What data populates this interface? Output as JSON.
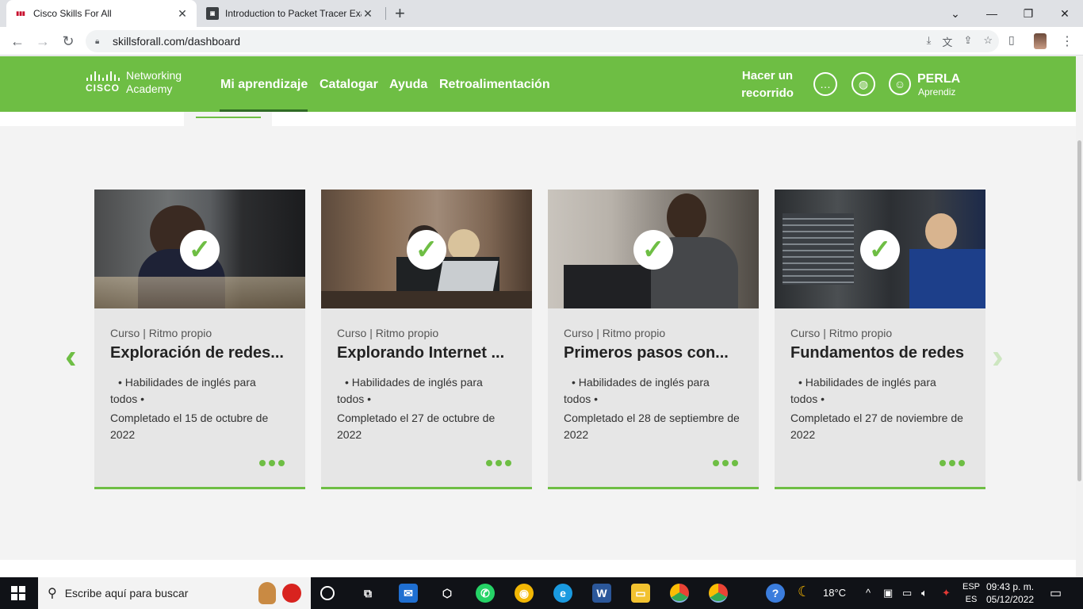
{
  "browser": {
    "tabs": [
      {
        "title": "Cisco Skills For All",
        "active": true,
        "favicon": "cisco-favicon"
      },
      {
        "title": "Introduction to Packet Tracer Exa",
        "active": false,
        "favicon": "packet-tracer-favicon"
      }
    ],
    "url": "skillsforall.com/dashboard"
  },
  "header": {
    "logo_cisco": "CISCO",
    "logo_networking": "Networking",
    "logo_academy": "Academy",
    "nav": [
      "Mi aprendizaje",
      "Catalogar",
      "Ayuda",
      "Retroalimentación"
    ],
    "tour_line1": "Hacer un",
    "tour_line2": "recorrido",
    "user_name": "PERLA",
    "user_role": "Aprendiz"
  },
  "cards": [
    {
      "meta": "Curso | Ritmo propio",
      "title": "Exploración de redes...",
      "bullet_line1": "•  Habilidades de inglés para",
      "bullet_line2": "todos  •",
      "completed": "Completado el 15 de octubre de 2022"
    },
    {
      "meta": "Curso | Ritmo propio",
      "title": "Explorando Internet ...",
      "bullet_line1": "•  Habilidades de inglés para",
      "bullet_line2": "todos  •",
      "completed": "Completado el 27 de octubre de 2022"
    },
    {
      "meta": "Curso | Ritmo propio",
      "title": "Primeros pasos con...",
      "bullet_line1": "•  Habilidades de inglés para",
      "bullet_line2": "todos  •",
      "completed": "Completado el 28 de septiembre de 2022"
    },
    {
      "meta": "Curso | Ritmo propio",
      "title": "Fundamentos de redes",
      "bullet_line1": "•  Habilidades de inglés para",
      "bullet_line2": "todos  •",
      "completed": "Completado el 27 de noviembre de 2022"
    }
  ],
  "taskbar": {
    "search_placeholder": "Escribe aquí para buscar",
    "temperature": "18°C",
    "lang_top": "ESP",
    "lang_bottom": "ES",
    "time": "09:43 p. m.",
    "date": "05/12/2022"
  },
  "colors": {
    "brand_green": "#6ebe44",
    "dark_green": "#2f6b25"
  }
}
